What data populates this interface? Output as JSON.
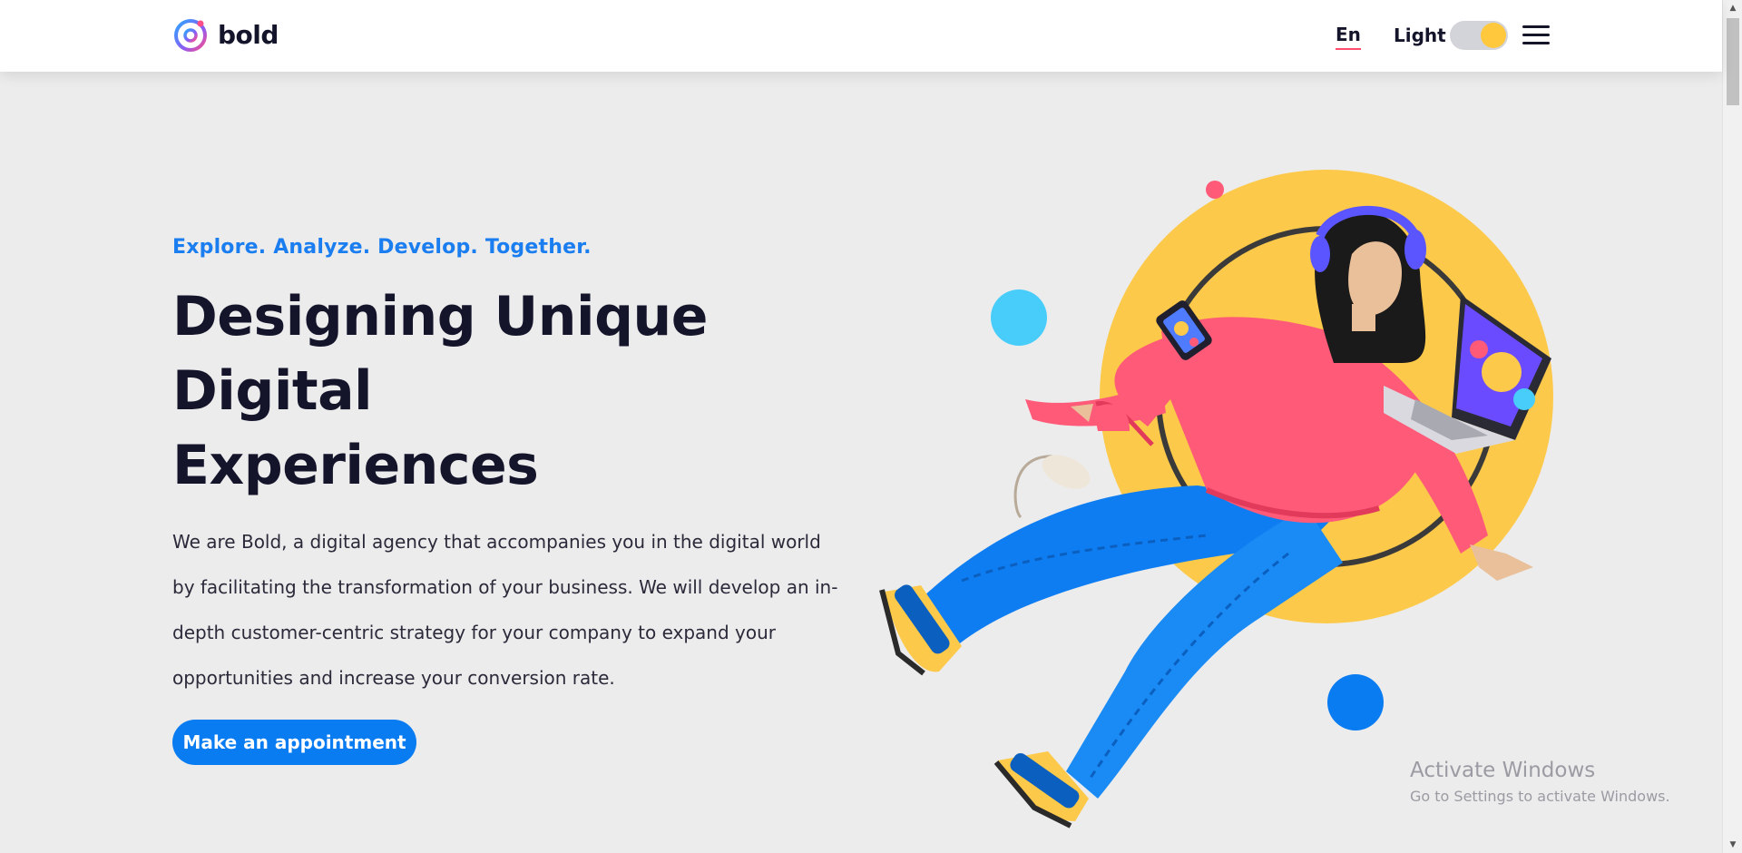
{
  "header": {
    "logo_text": "bold",
    "language": "En",
    "theme_label": "Light",
    "theme_toggle_state": "light",
    "colors": {
      "accent": "#1a7df0",
      "underline": "#ff4d6d",
      "toggle_knob": "#ffc83d"
    }
  },
  "hero": {
    "tagline": "Explore. Analyze. Develop. Together.",
    "headline": [
      "Designing Unique",
      "Digital",
      "Experiences"
    ],
    "description": "We are Bold, a digital agency that accompanies you in the digital world by facilitating the transformation of your business. We will develop an in-depth customer-centric strategy for your company to expand your opportunities and increase your conversion rate.",
    "cta_label": "Make an appointment"
  },
  "watermark": {
    "title": "Activate Windows",
    "subtitle": "Go to Settings to activate Windows."
  }
}
